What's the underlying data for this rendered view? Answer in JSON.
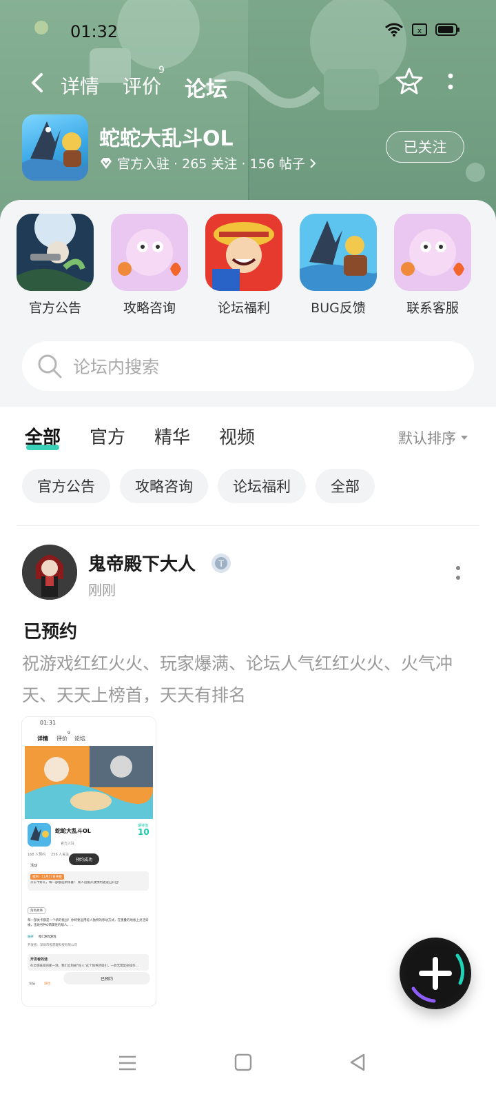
{
  "status_bar": {
    "time": "01:32"
  },
  "header": {
    "tabs": [
      {
        "label": "详情"
      },
      {
        "label": "评价",
        "badge": "9"
      },
      {
        "label": "论坛"
      }
    ],
    "active_tab": "论坛"
  },
  "game": {
    "title": "蛇蛇大乱斗OL",
    "meta": "官方入驻 · 265 关注 · 156 帖子",
    "follow_label": "已关注"
  },
  "categories": [
    {
      "label": "官方公告"
    },
    {
      "label": "攻略咨询"
    },
    {
      "label": "论坛福利"
    },
    {
      "label": "BUG反馈"
    },
    {
      "label": "联系客服"
    }
  ],
  "search": {
    "placeholder": "论坛内搜索"
  },
  "filter_tabs": [
    {
      "label": "全部"
    },
    {
      "label": "官方"
    },
    {
      "label": "精华"
    },
    {
      "label": "视频"
    }
  ],
  "sort_label": "默认排序",
  "chips": [
    {
      "label": "官方公告"
    },
    {
      "label": "攻略咨询"
    },
    {
      "label": "论坛福利"
    },
    {
      "label": "全部"
    }
  ],
  "post": {
    "author": "鬼帝殿下大人",
    "time": "刚刚",
    "title": "已预约",
    "body": "祝游戏红红火火、玩家爆满、论坛人气红红火火、火气冲天、天天上榜首，天天有排名",
    "screenshot": {
      "time": "01:31",
      "tabs": [
        "详情",
        "评价",
        "论坛"
      ],
      "tab_badge": "9",
      "game_title": "蛇蛇大乱斗OL",
      "official": "官方入驻",
      "score_label": "期待值",
      "score": "10",
      "stats": "168 人预约     256 人关注",
      "toast": "预约成功",
      "activity": "活动",
      "news_tag": "福利 · 11月17日开服",
      "news_text": "京东卡好礼，每一部都是新惊喜！ 现人首服开放预约通道已开启！",
      "section_tag": "角色故事",
      "desc": "每一部关卡都是一个新的挑战！你将要运用蛇人独特的移动方式，在重叠的地板上灵活穿梭，击败各种Q萌属性的敌人。…",
      "more": "展开",
      "dev_label": "橙C游戏游戏",
      "dev_info": "开发者：深圳市橙游趣科技有限公司",
      "dev_say_title": "开发者的话",
      "dev_say": "在灵感迸发的那一刻，我们立刻被\"蛇人\"这个角色所吸引，一款无需复杂操作…",
      "bottom_left": "论坛",
      "bottom_mid": "游戏",
      "bottom_btn": "已预约"
    }
  },
  "colors": {
    "accent": "#19c9ad",
    "hero_bg": "#6e9a80",
    "card_bg": "#f4f5f7",
    "muted_text": "#9a9a9a"
  },
  "icons": {
    "back": "chevron-left-icon",
    "star": "star-follow-icon",
    "more": "more-vertical-icon",
    "search": "search-icon",
    "fab": "plus-icon",
    "official": "diamond-verified-icon"
  }
}
